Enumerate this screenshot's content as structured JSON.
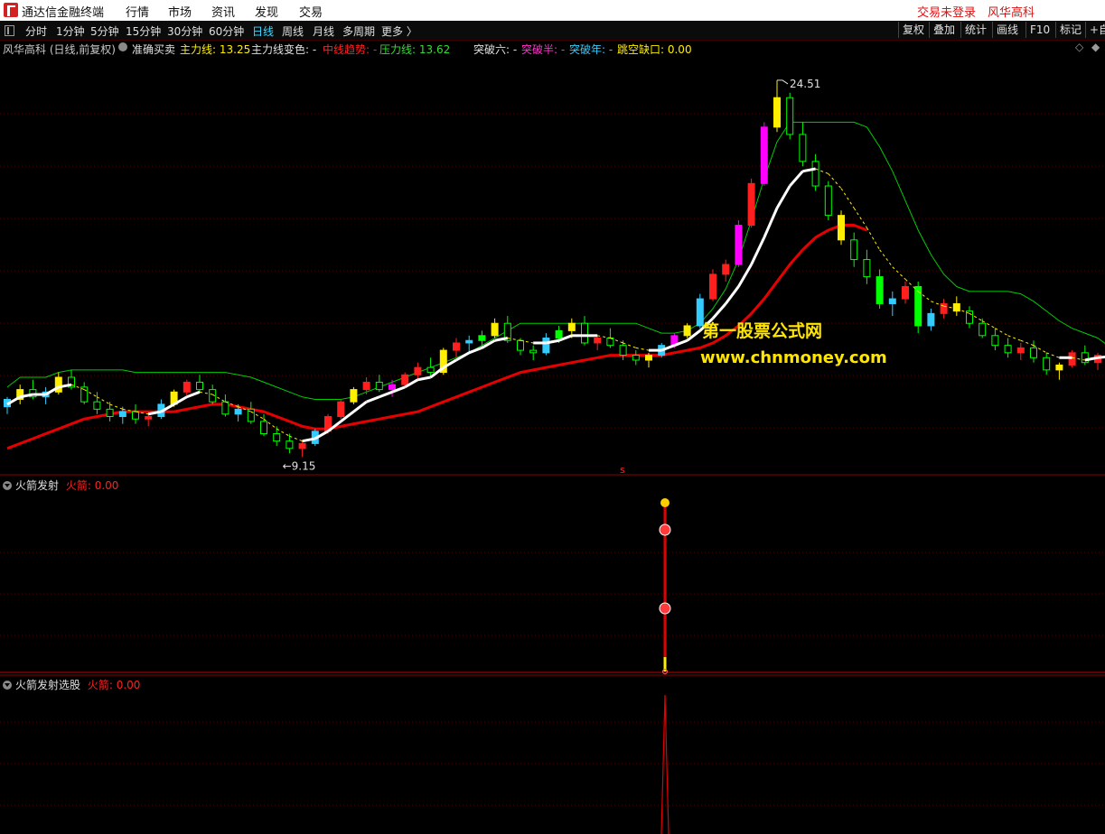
{
  "app": {
    "title": "通达信金融终端",
    "login_status": "交易未登录",
    "stock_name": "风华高科"
  },
  "top_menu": [
    {
      "label": "行情"
    },
    {
      "label": "市场"
    },
    {
      "label": "资讯"
    },
    {
      "label": "发现"
    },
    {
      "label": "交易"
    }
  ],
  "periods": [
    {
      "label": "分时"
    },
    {
      "label": "1分钟"
    },
    {
      "label": "5分钟"
    },
    {
      "label": "15分钟"
    },
    {
      "label": "30分钟"
    },
    {
      "label": "60分钟"
    },
    {
      "label": "日线"
    },
    {
      "label": "周线"
    },
    {
      "label": "月线"
    },
    {
      "label": "多周期"
    },
    {
      "label": "更多 〉"
    }
  ],
  "active_period": "日线",
  "toolbar": [
    {
      "label": "复权"
    },
    {
      "label": "叠加"
    },
    {
      "label": "统计"
    },
    {
      "label": "画线"
    },
    {
      "label": "F10"
    },
    {
      "label": "标记"
    },
    {
      "label": "+自"
    }
  ],
  "main_panel": {
    "header": "风华高科 (日线,前复权)",
    "indicator_name": "准确买卖",
    "main_line": "主力线: 13.25",
    "main_line_change": "主力线变色: -",
    "mid_trend": "中线趋势: -",
    "pressure_line": "压力线: 13.62",
    "breakout6": "突破六: -",
    "breakout_half": "突破半: -",
    "breakout_year": "突破年: -",
    "gap": "跳空缺口: 0.00",
    "high_label": "24.51",
    "low_label": "←9.15",
    "center_marker": "s"
  },
  "sub_panel_1": {
    "name": "火箭发射",
    "value": "火箭: 0.00"
  },
  "sub_panel_2": {
    "name": "火箭发射选股",
    "value": "火箭: 0.00"
  },
  "watermark": {
    "line1": "第一股票公式网",
    "line2": "www.chnmoney.com"
  },
  "colors": {
    "up": "#ff1f1f",
    "down": "#00ff00",
    "signal_yellow": "#ffee00",
    "signal_magenta": "#ff00ff",
    "cyan": "#33ccff",
    "white_line": "#ffffff",
    "red_line": "#e60000",
    "green_line": "#00cc00",
    "panel_border": "#8a0000",
    "grid": "#5a0000"
  },
  "chart_data": {
    "type": "candlestick",
    "title": "风华高科 (日线,前复权)",
    "price_range": [
      8.5,
      25.5
    ],
    "candles": [
      [
        11.2,
        11.6,
        10.9,
        11.5
      ],
      [
        11.5,
        12.1,
        11.3,
        11.9
      ],
      [
        11.9,
        12.3,
        11.5,
        11.6
      ],
      [
        11.6,
        12.0,
        11.3,
        11.8
      ],
      [
        11.8,
        12.6,
        11.7,
        12.4
      ],
      [
        12.4,
        12.7,
        11.9,
        12.0
      ],
      [
        12.0,
        12.2,
        11.3,
        11.4
      ],
      [
        11.4,
        11.8,
        10.9,
        11.1
      ],
      [
        11.1,
        11.4,
        10.6,
        10.8
      ],
      [
        10.8,
        11.2,
        10.5,
        11.0
      ],
      [
        11.0,
        11.3,
        10.5,
        10.7
      ],
      [
        10.7,
        11.0,
        10.4,
        10.8
      ],
      [
        10.8,
        11.5,
        10.7,
        11.3
      ],
      [
        11.3,
        11.9,
        11.2,
        11.8
      ],
      [
        11.8,
        12.3,
        11.6,
        12.2
      ],
      [
        12.2,
        12.5,
        11.8,
        11.9
      ],
      [
        11.9,
        12.1,
        11.3,
        11.4
      ],
      [
        11.4,
        11.7,
        10.8,
        10.9
      ],
      [
        10.9,
        11.3,
        10.6,
        11.1
      ],
      [
        11.1,
        11.4,
        10.5,
        10.6
      ],
      [
        10.6,
        10.9,
        10.0,
        10.1
      ],
      [
        10.1,
        10.4,
        9.6,
        9.8
      ],
      [
        9.8,
        10.1,
        9.3,
        9.5
      ],
      [
        9.5,
        9.8,
        9.15,
        9.7
      ],
      [
        9.7,
        10.3,
        9.6,
        10.2
      ],
      [
        10.2,
        10.9,
        10.1,
        10.8
      ],
      [
        10.8,
        11.5,
        10.7,
        11.4
      ],
      [
        11.4,
        12.0,
        11.3,
        11.9
      ],
      [
        11.9,
        12.4,
        11.7,
        12.2
      ],
      [
        12.2,
        12.5,
        11.8,
        11.9
      ],
      [
        11.9,
        12.3,
        11.6,
        12.1
      ],
      [
        12.1,
        12.6,
        12.0,
        12.5
      ],
      [
        12.5,
        13.0,
        12.3,
        12.8
      ],
      [
        12.8,
        13.2,
        12.4,
        12.6
      ],
      [
        12.6,
        13.6,
        12.5,
        13.5
      ],
      [
        13.5,
        14.0,
        13.2,
        13.8
      ],
      [
        13.8,
        14.1,
        13.4,
        13.9
      ],
      [
        13.9,
        14.3,
        13.6,
        14.1
      ],
      [
        14.1,
        14.8,
        14.0,
        14.6
      ],
      [
        14.6,
        14.9,
        13.8,
        13.9
      ],
      [
        13.9,
        14.0,
        13.3,
        13.5
      ],
      [
        13.5,
        13.7,
        13.1,
        13.4
      ],
      [
        13.4,
        14.2,
        13.3,
        14.0
      ],
      [
        14.0,
        14.5,
        13.8,
        14.3
      ],
      [
        14.3,
        14.8,
        14.0,
        14.6
      ],
      [
        14.6,
        14.9,
        13.7,
        13.8
      ],
      [
        13.8,
        14.1,
        13.5,
        14.0
      ],
      [
        14.0,
        14.4,
        13.6,
        13.7
      ],
      [
        13.7,
        13.9,
        13.1,
        13.3
      ],
      [
        13.3,
        13.5,
        12.9,
        13.1
      ],
      [
        13.1,
        13.4,
        12.8,
        13.3
      ],
      [
        13.3,
        13.8,
        13.2,
        13.7
      ],
      [
        13.7,
        14.2,
        13.6,
        14.1
      ],
      [
        14.1,
        14.6,
        14.0,
        14.5
      ],
      [
        14.5,
        15.8,
        14.4,
        15.6
      ],
      [
        15.6,
        16.8,
        15.5,
        16.6
      ],
      [
        16.6,
        17.2,
        16.3,
        17.0
      ],
      [
        17.0,
        18.8,
        16.9,
        18.6
      ],
      [
        18.6,
        20.5,
        18.5,
        20.3
      ],
      [
        20.3,
        22.8,
        20.2,
        22.6
      ],
      [
        22.6,
        24.51,
        22.4,
        23.8
      ],
      [
        23.8,
        24.0,
        22.1,
        22.3
      ],
      [
        22.3,
        22.8,
        21.0,
        21.2
      ],
      [
        21.2,
        21.5,
        20.0,
        20.2
      ],
      [
        20.2,
        20.4,
        18.8,
        19.0
      ],
      [
        19.0,
        19.2,
        17.8,
        18.0
      ],
      [
        18.0,
        18.3,
        16.9,
        17.2
      ],
      [
        17.2,
        17.6,
        16.2,
        16.5
      ],
      [
        16.5,
        16.8,
        15.2,
        15.4
      ],
      [
        15.4,
        15.9,
        14.9,
        15.6
      ],
      [
        15.6,
        16.3,
        15.4,
        16.1
      ],
      [
        16.1,
        16.3,
        14.2,
        14.5
      ],
      [
        14.5,
        15.2,
        14.3,
        15.0
      ],
      [
        15.0,
        15.6,
        14.8,
        15.4
      ],
      [
        15.4,
        15.7,
        14.9,
        15.1
      ],
      [
        15.1,
        15.3,
        14.4,
        14.6
      ],
      [
        14.6,
        14.8,
        14.0,
        14.1
      ],
      [
        14.1,
        14.4,
        13.5,
        13.7
      ],
      [
        13.7,
        14.0,
        13.2,
        13.4
      ],
      [
        13.4,
        13.8,
        13.1,
        13.6
      ],
      [
        13.6,
        13.9,
        13.0,
        13.2
      ],
      [
        13.2,
        13.4,
        12.5,
        12.7
      ],
      [
        12.7,
        13.0,
        12.3,
        12.9
      ],
      [
        12.9,
        13.5,
        12.8,
        13.4
      ],
      [
        13.4,
        13.7,
        12.9,
        13.0
      ],
      [
        13.0,
        13.4,
        12.7,
        13.3
      ],
      [
        13.3,
        13.6,
        12.9,
        13.2
      ]
    ],
    "series": [
      {
        "name": "主力线",
        "values": [
          11.3,
          11.6,
          11.7,
          11.7,
          12.0,
          12.1,
          11.9,
          11.6,
          11.3,
          11.1,
          11.0,
          10.9,
          11.0,
          11.3,
          11.6,
          11.8,
          11.7,
          11.4,
          11.2,
          11.0,
          10.7,
          10.3,
          10.0,
          9.8,
          9.9,
          10.2,
          10.6,
          11.0,
          11.4,
          11.6,
          11.8,
          12.0,
          12.3,
          12.4,
          12.8,
          13.1,
          13.4,
          13.6,
          13.9,
          14.0,
          13.9,
          13.8,
          13.8,
          13.9,
          14.1,
          14.1,
          14.1,
          14.0,
          13.8,
          13.6,
          13.5,
          13.5,
          13.7,
          13.9,
          14.3,
          14.8,
          15.4,
          16.1,
          17.0,
          18.1,
          19.3,
          20.2,
          20.8,
          20.9,
          20.7,
          20.1,
          19.3,
          18.5,
          17.6,
          16.9,
          16.4,
          15.9,
          15.5,
          15.3,
          15.2,
          15.0,
          14.7,
          14.4,
          14.1,
          13.9,
          13.7,
          13.4,
          13.2,
          13.2,
          13.1,
          13.2,
          13.25
        ]
      },
      {
        "name": "中线趋势",
        "values": [
          9.5,
          9.7,
          9.9,
          10.1,
          10.3,
          10.5,
          10.7,
          10.8,
          10.9,
          11.0,
          11.0,
          11.0,
          11.0,
          11.0,
          11.1,
          11.2,
          11.3,
          11.3,
          11.2,
          11.1,
          11.0,
          10.8,
          10.6,
          10.4,
          10.3,
          10.3,
          10.4,
          10.5,
          10.6,
          10.7,
          10.8,
          10.9,
          11.0,
          11.2,
          11.4,
          11.6,
          11.8,
          12.0,
          12.2,
          12.4,
          12.6,
          12.7,
          12.8,
          12.9,
          13.0,
          13.1,
          13.2,
          13.3,
          13.3,
          13.3,
          13.3,
          13.3,
          13.4,
          13.5,
          13.6,
          13.8,
          14.1,
          14.5,
          15.0,
          15.6,
          16.3,
          17.0,
          17.6,
          18.1,
          18.4,
          18.6,
          18.6,
          18.4
        ]
      },
      {
        "name": "压力线",
        "values": [
          12.0,
          12.4,
          12.4,
          12.4,
          12.6,
          12.7,
          12.7,
          12.7,
          12.7,
          12.7,
          12.6,
          12.6,
          12.6,
          12.6,
          12.6,
          12.6,
          12.6,
          12.6,
          12.5,
          12.4,
          12.2,
          12.0,
          11.8,
          11.6,
          11.5,
          11.5,
          11.5,
          11.6,
          11.8,
          12.0,
          12.2,
          12.4,
          12.6,
          12.8,
          13.0,
          13.2,
          13.4,
          13.7,
          14.0,
          14.3,
          14.6,
          14.6,
          14.6,
          14.6,
          14.6,
          14.6,
          14.6,
          14.6,
          14.6,
          14.6,
          14.4,
          14.2,
          14.2,
          14.3,
          14.6,
          15.2,
          16.0,
          17.2,
          18.8,
          20.5,
          22.0,
          22.8,
          22.8,
          22.8,
          22.8,
          22.8,
          22.8,
          22.6,
          21.8,
          20.8,
          19.6,
          18.4,
          17.4,
          16.6,
          16.1,
          15.9,
          15.9,
          15.9,
          15.9,
          15.8,
          15.5,
          15.1,
          14.7,
          14.4,
          14.2,
          14.0,
          13.62
        ]
      }
    ],
    "rocket_signal": {
      "index": 60,
      "peak": 1.0
    },
    "rocket_select": {
      "index": 60,
      "peak": 1.0
    }
  }
}
